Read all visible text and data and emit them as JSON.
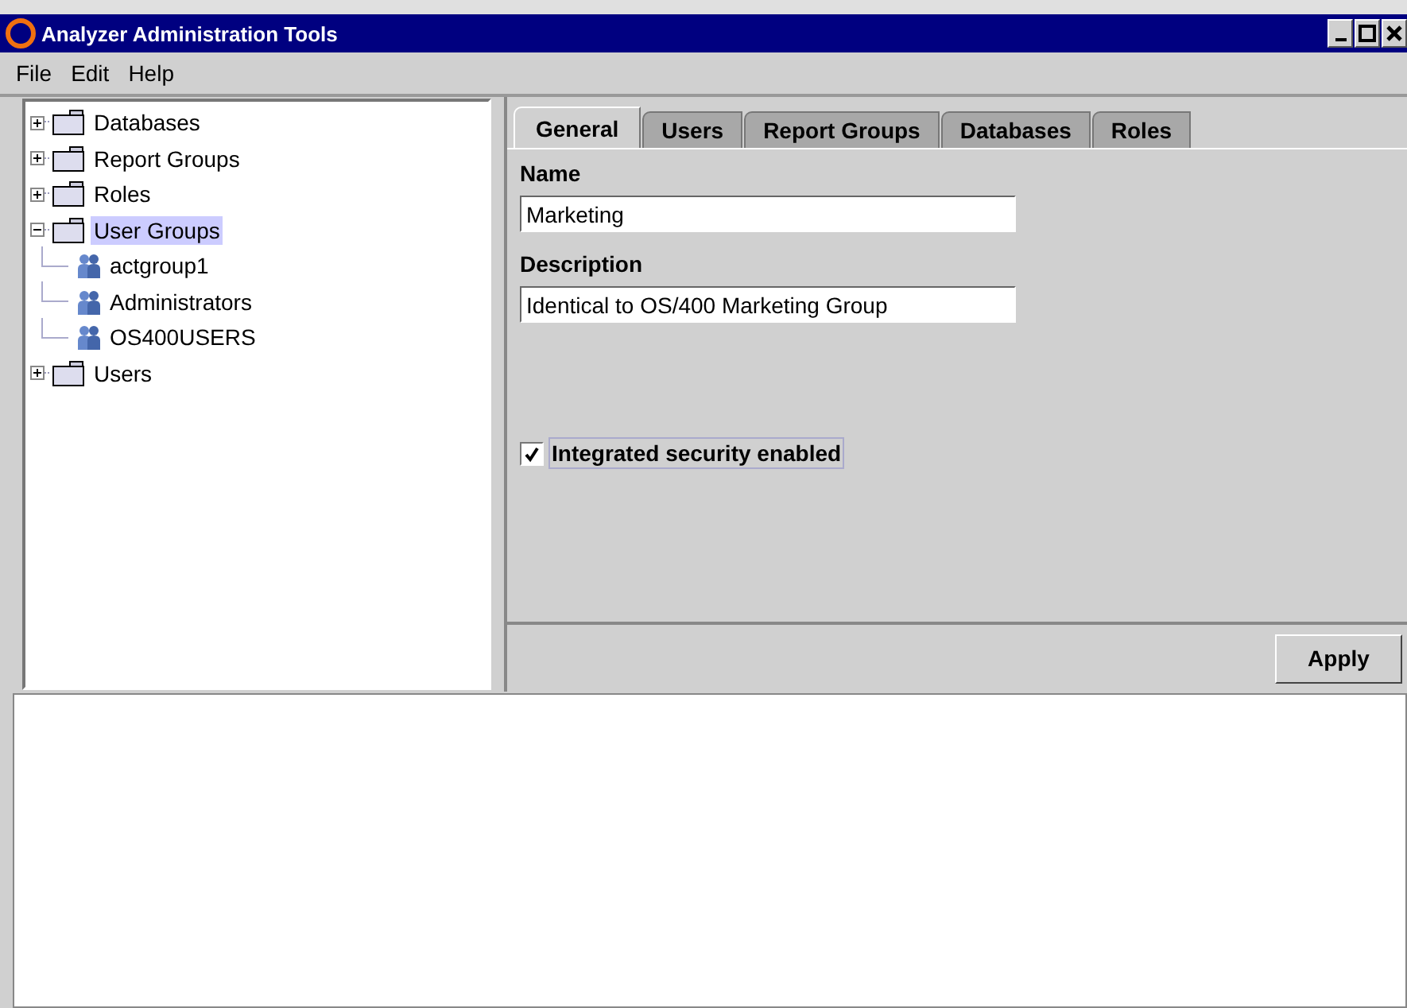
{
  "window": {
    "title": "Analyzer Administration Tools"
  },
  "menu": [
    "File",
    "Edit",
    "Help"
  ],
  "tree": [
    {
      "label": "Databases",
      "kind": "folder",
      "expanded": false,
      "selected": false
    },
    {
      "label": "Report Groups",
      "kind": "folder",
      "expanded": false,
      "selected": false
    },
    {
      "label": "Roles",
      "kind": "folder",
      "expanded": false,
      "selected": false
    },
    {
      "label": "User Groups",
      "kind": "folder",
      "expanded": true,
      "selected": true,
      "children": [
        {
          "label": "actgroup1",
          "kind": "group",
          "selected": false
        },
        {
          "label": "Administrators",
          "kind": "group",
          "selected": false
        },
        {
          "label": "OS400USERS",
          "kind": "group",
          "selected": false
        }
      ]
    },
    {
      "label": "Users",
      "kind": "folder",
      "expanded": false,
      "selected": false
    }
  ],
  "tabs": [
    {
      "label": "General",
      "selected": true
    },
    {
      "label": "Users",
      "selected": false
    },
    {
      "label": "Report Groups",
      "selected": false
    },
    {
      "label": "Databases",
      "selected": false
    },
    {
      "label": "Roles",
      "selected": false
    }
  ],
  "form": {
    "name_label": "Name",
    "name_value": "Marketing",
    "description_label": "Description",
    "description_value": "Identical to OS/400 Marketing Group",
    "integrated_security": {
      "label": "Integrated security enabled",
      "checked": true
    }
  },
  "buttons": [
    "Apply"
  ]
}
